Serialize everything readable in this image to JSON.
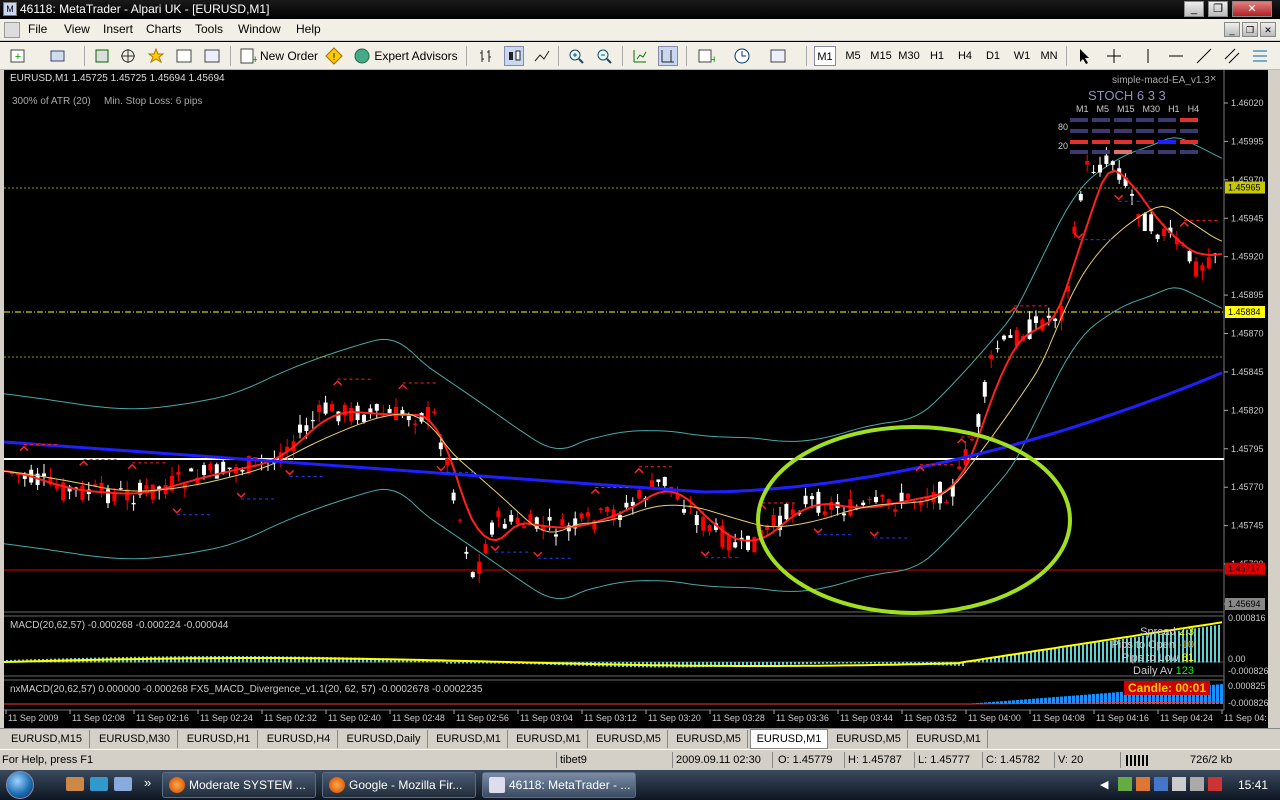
{
  "window": {
    "title": "46118: MetaTrader - Alpari UK - [EURUSD,M1]",
    "minimize": "_",
    "restore": "❐",
    "close": "✕"
  },
  "menu": [
    "File",
    "View",
    "Insert",
    "Charts",
    "Tools",
    "Window",
    "Help"
  ],
  "toolbar": {
    "new_order": "New Order",
    "expert_advisors": "Expert Advisors",
    "timeframes": [
      "M1",
      "M5",
      "M15",
      "M30",
      "H1",
      "H4",
      "D1",
      "W1",
      "MN"
    ]
  },
  "chart": {
    "header": "EURUSD,M1  1.45725 1.45725 1.45694 1.45694",
    "atr_label": "300% of ATR (20)",
    "stoploss_label": "Min. Stop Loss:   6 pips",
    "ea_label": "simple-macd-EA_v1.3",
    "stoch_title": "STOCH  6 3 3",
    "stoch_tfs": [
      "M1",
      "M5",
      "M15",
      "M30",
      "H1",
      "H4"
    ],
    "stoch_levels": [
      "80",
      "20"
    ],
    "price_ticks": [
      "1.46020",
      "1.45995",
      "1.45970",
      "1.45945",
      "1.45920",
      "1.45895",
      "1.45870",
      "1.45845",
      "1.45820",
      "1.45795",
      "1.45770",
      "1.45745",
      "1.45720",
      "1.45694"
    ],
    "price_markers": [
      {
        "value": "1.45965",
        "color": "#c8c800"
      },
      {
        "value": "1.45884",
        "color": "#ffff00"
      },
      {
        "value": "1.45717",
        "color": "#e00000"
      },
      {
        "value": "1.45694",
        "color": "#888888"
      }
    ],
    "time_ticks": [
      "11 Sep 2009",
      "11 Sep 02:08",
      "11 Sep 02:16",
      "11 Sep 02:24",
      "11 Sep 02:32",
      "11 Sep 02:40",
      "11 Sep 02:48",
      "11 Sep 02:56",
      "11 Sep 03:04",
      "11 Sep 03:12",
      "11 Sep 03:20",
      "11 Sep 03:28",
      "11 Sep 03:36",
      "11 Sep 03:44",
      "11 Sep 03:52",
      "11 Sep 04:00",
      "11 Sep 04:08",
      "11 Sep 04:16",
      "11 Sep 04:24",
      "11 Sep 04:"
    ],
    "macd_label": "MACD(20,62,57) -0.000268 -0.000224 -0.000044",
    "macd_ticks": [
      "0.000816",
      "0.00",
      "-0.000826"
    ],
    "macd_overlay": [
      {
        "label": "Spread",
        "value": "2.3"
      },
      {
        "label": "Pips to Open",
        "value": "-10"
      },
      {
        "label": "Pips to Low",
        "value": "81"
      },
      {
        "label": "Daily Av",
        "value": "123"
      }
    ],
    "nxmacd_label": "nxMACD(20,62,57) 0.000000 -0.000268   FX5_MACD_Divergence_v1.1(20, 62, 57) -0.0002678 -0.0002235",
    "nxmacd_ticks": [
      "0.000825",
      "-0.000826"
    ],
    "candle_label": "Candle:  00:01"
  },
  "tabs": [
    "EURUSD,M15",
    "EURUSD,M30",
    "EURUSD,H1",
    "EURUSD,H4",
    "EURUSD,Daily",
    "EURUSD,M1",
    "EURUSD,M1",
    "EURUSD,M5",
    "EURUSD,M5",
    "EURUSD,M1",
    "EURUSD,M5",
    "EURUSD,M1"
  ],
  "active_tab_index": 9,
  "status": {
    "help": "For Help, press F1",
    "profile": "tibet9",
    "datetime": "2009.09.11 02:30",
    "open": "O: 1.45779",
    "high": "H: 1.45787",
    "low": "L: 1.45777",
    "close": "C: 1.45782",
    "volume": "V: 20",
    "traffic": "726/2 kb"
  },
  "taskbar": {
    "tasks": [
      "Moderate SYSTEM ...",
      "Google - Mozilla Fir...",
      "46118: MetaTrader - ..."
    ],
    "clock": "15:41"
  },
  "colors": {
    "bull": "#ffffff",
    "bear": "#ff0000",
    "ma_red": "#ff2020",
    "ma_blue": "#2020ff",
    "ma_yellow": "#e8d070",
    "band": "#4aa8a8",
    "ellipse": "#a0e020"
  }
}
